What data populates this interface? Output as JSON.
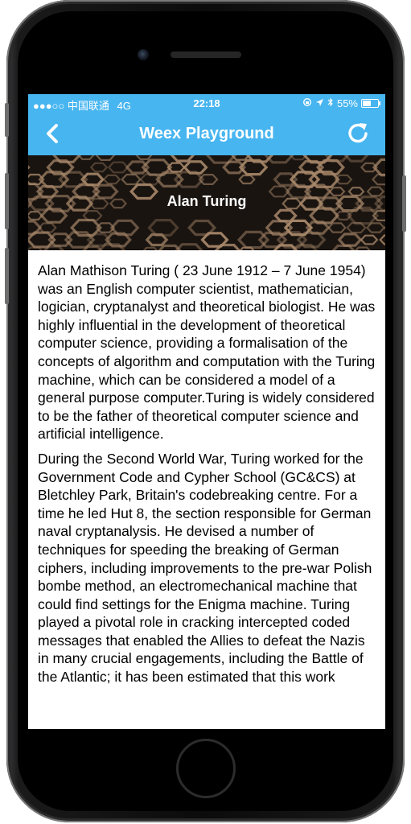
{
  "status_bar": {
    "carrier": "●●●○○ 中国联通",
    "network": "4G",
    "time": "22:18",
    "icons": [
      "rotation-lock-icon",
      "location-icon",
      "bluetooth-icon"
    ],
    "battery_text": "55%",
    "battery_level": 0.55
  },
  "nav": {
    "title": "Weex Playground",
    "back_icon": "chevron-left-icon",
    "refresh_icon": "refresh-icon"
  },
  "banner": {
    "title": "Alan Turing"
  },
  "article": {
    "paragraphs": [
      "Alan Mathison Turing ( 23 June 1912 – 7 June 1954) was an English computer scientist, mathematician, logician, cryptanalyst and theoretical biologist. He was highly influential in the development of theoretical computer science, providing a formalisation of the concepts of algorithm and computation with the Turing machine, which can be considered a model of a general purpose computer.Turing is widely considered to be the father of theoretical computer science and artificial intelligence.",
      "During the Second World War, Turing worked for the Government Code and Cypher School (GC&CS) at Bletchley Park, Britain's codebreaking centre. For a time he led Hut 8, the section responsible for German naval cryptanalysis. He devised a number of techniques for speeding the breaking of German ciphers, including improvements to the pre-war Polish bombe method, an electromechanical machine that could find settings for the Enigma machine. Turing played a pivotal role in cracking intercepted coded messages that enabled the Allies to defeat the Nazis in many crucial engagements, including the Battle of the Atlantic; it has been estimated that this work"
    ]
  },
  "colors": {
    "accent": "#47b5f0",
    "banner_bg": "#1a1410",
    "hexagon": "#a8886a"
  }
}
